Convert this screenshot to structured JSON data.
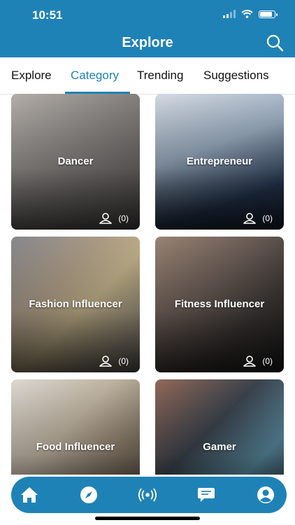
{
  "status_bar": {
    "time": "10:51"
  },
  "header": {
    "title": "Explore",
    "search_icon": "search-icon"
  },
  "tabs": [
    {
      "label": "Explore",
      "active": false
    },
    {
      "label": "Category",
      "active": true
    },
    {
      "label": "Trending",
      "active": false
    },
    {
      "label": "Suggestions",
      "active": false
    }
  ],
  "categories": [
    {
      "name": "Dancer",
      "count": "(0)"
    },
    {
      "name": "Entrepreneur",
      "count": "(0)"
    },
    {
      "name": "Fashion Influencer",
      "count": "(0)"
    },
    {
      "name": "Fitness Influencer",
      "count": "(0)"
    },
    {
      "name": "Food Influencer",
      "count": ""
    },
    {
      "name": "Gamer",
      "count": ""
    }
  ],
  "bottom_nav": [
    "home-icon",
    "compass-icon",
    "broadcast-icon",
    "chat-icon",
    "profile-icon"
  ],
  "colors": {
    "accent": "#1f82b6",
    "nav": "#1f82b6"
  }
}
